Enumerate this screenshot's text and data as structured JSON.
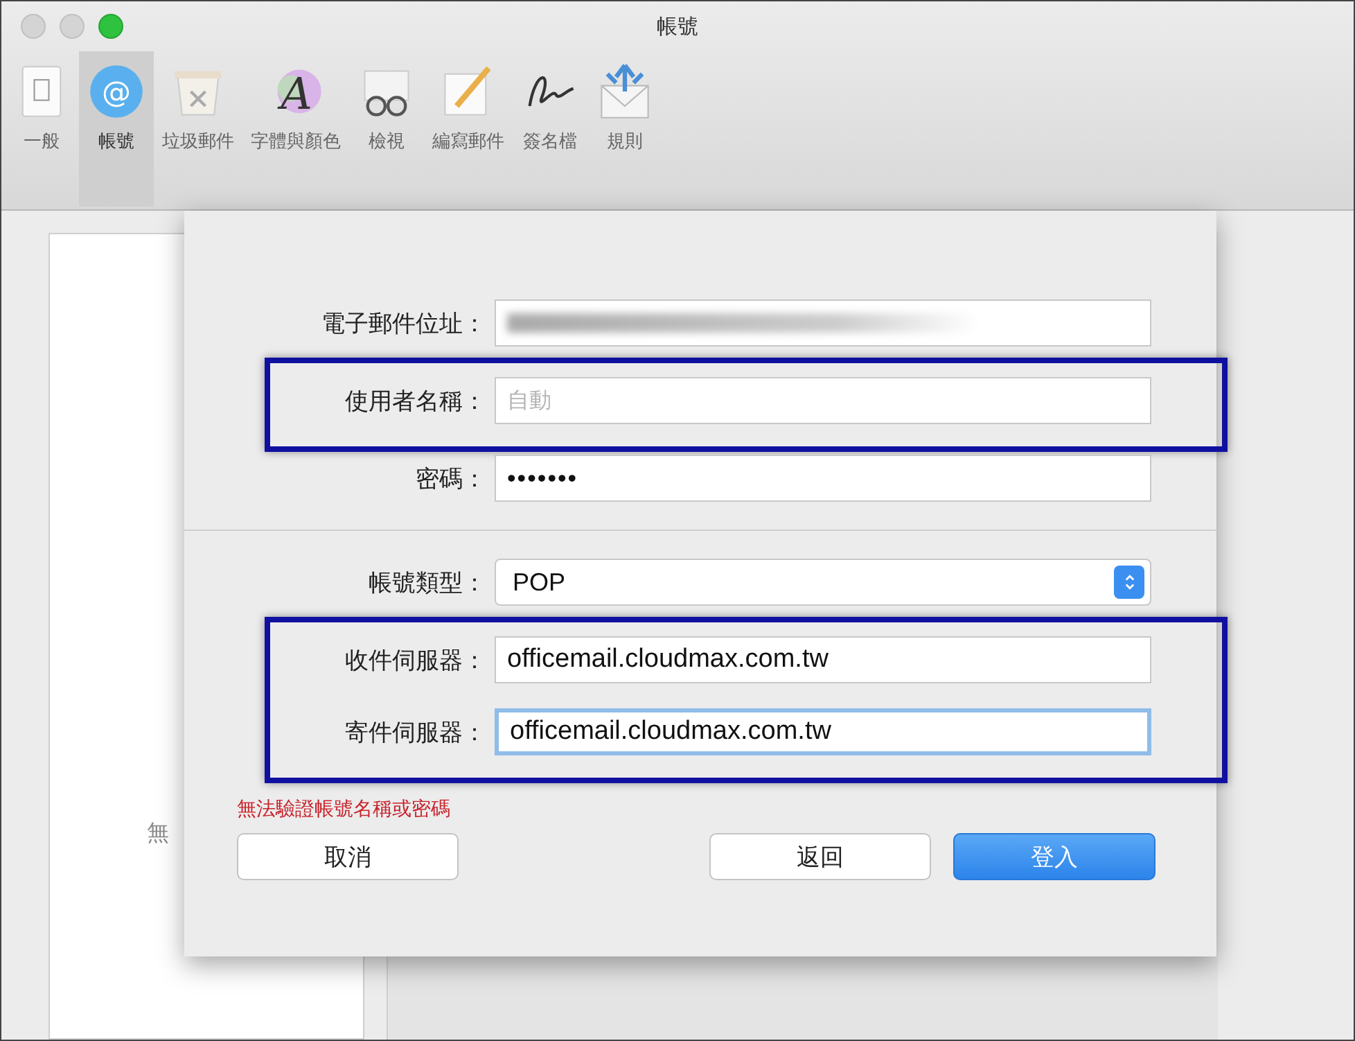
{
  "window": {
    "title": "帳號"
  },
  "toolbar": [
    {
      "label": "一般",
      "selected": false
    },
    {
      "label": "帳號",
      "selected": true,
      "glyph": "@"
    },
    {
      "label": "垃圾郵件",
      "selected": false
    },
    {
      "label": "字體與顏色",
      "selected": false,
      "glyph": "A"
    },
    {
      "label": "檢視",
      "selected": false
    },
    {
      "label": "編寫郵件",
      "selected": false
    },
    {
      "label": "簽名檔",
      "selected": false
    },
    {
      "label": "規則",
      "selected": false
    }
  ],
  "background": {
    "list_text": "無"
  },
  "dialog": {
    "sections": [
      {
        "groups": [
          {
            "highlighted": false,
            "fields": [
              {
                "label": "電子郵件位址：",
                "kind": "redacted",
                "focused": false
              }
            ]
          },
          {
            "highlighted": true,
            "fields": [
              {
                "label": "使用者名稱：",
                "kind": "text",
                "placeholder": "自動",
                "focused": false
              }
            ]
          },
          {
            "highlighted": false,
            "fields": [
              {
                "label": "密碼：",
                "kind": "password",
                "value": "•••••••",
                "focused": false
              }
            ]
          }
        ]
      },
      {
        "groups": [
          {
            "highlighted": false,
            "fields": [
              {
                "label": "帳號類型：",
                "kind": "select",
                "value": "POP",
                "focused": false
              }
            ]
          },
          {
            "highlighted": true,
            "fields": [
              {
                "label": "收件伺服器：",
                "kind": "text",
                "value": "officemail.cloudmax.com.tw",
                "focused": false
              },
              {
                "label": "寄件伺服器：",
                "kind": "text",
                "value": "officemail.cloudmax.com.tw",
                "focused": true
              }
            ]
          }
        ]
      }
    ],
    "error": "無法驗證帳號名稱或密碼",
    "buttons": [
      {
        "label": "取消",
        "primary": false
      },
      {
        "label": "返回",
        "primary": false
      },
      {
        "label": "登入",
        "primary": true
      }
    ]
  }
}
